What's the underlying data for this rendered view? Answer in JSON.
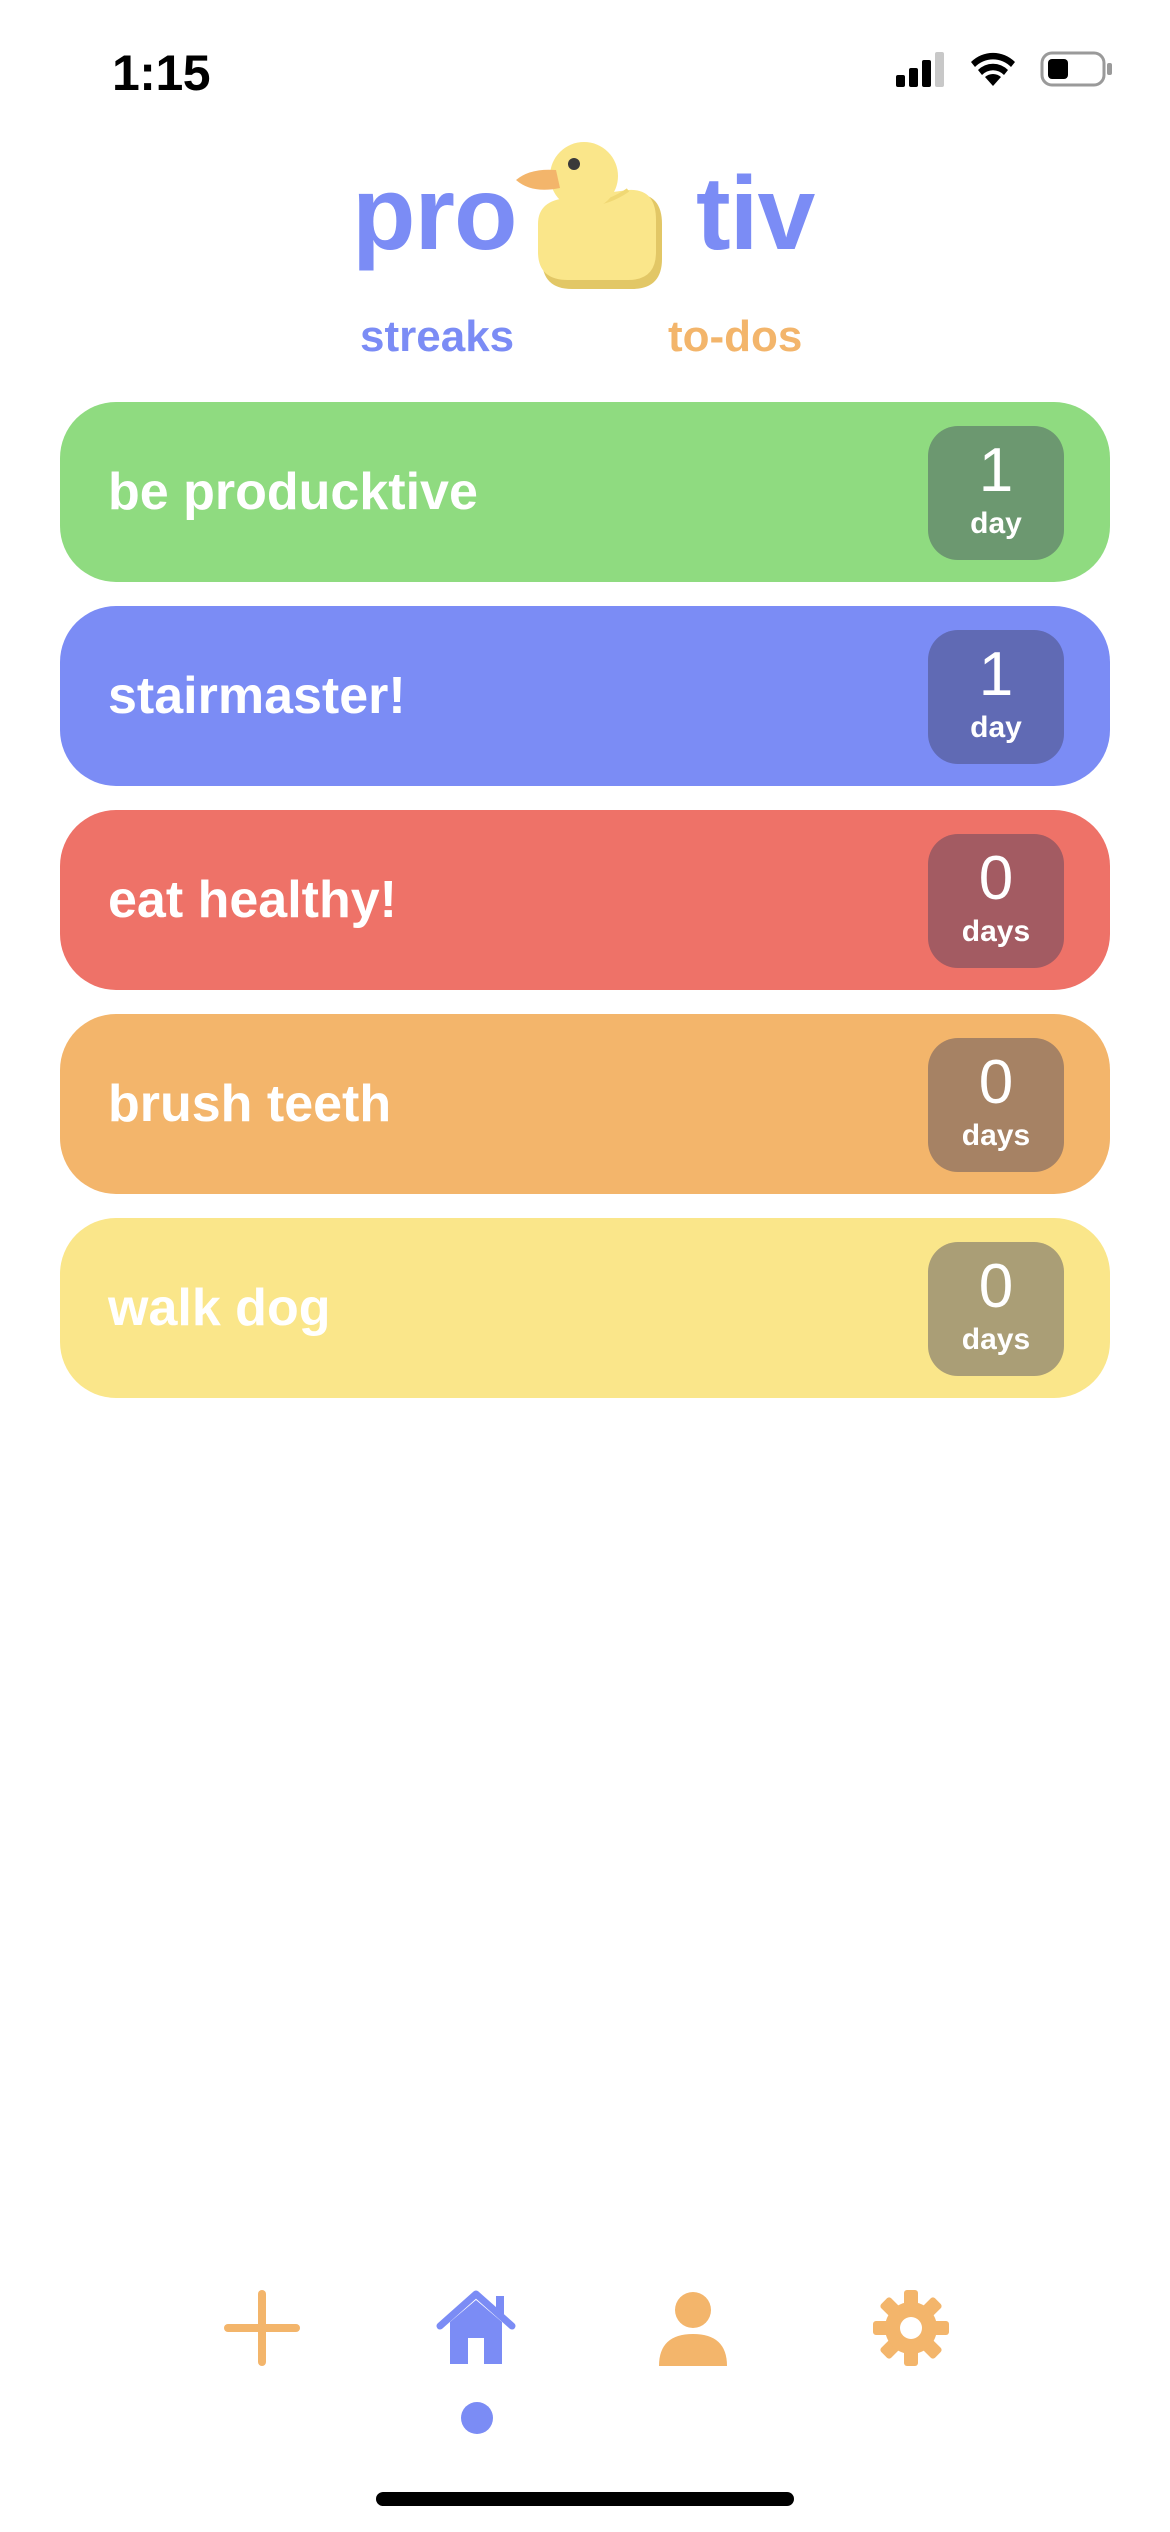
{
  "status_bar": {
    "time": "1:15"
  },
  "header": {
    "logo_left": "pro",
    "logo_right": "tiv",
    "mascot_icon": "duck-icon"
  },
  "tabs": [
    {
      "label": "streaks",
      "color": "#7b8cf5",
      "active": true
    },
    {
      "label": "to-dos",
      "color": "#f3b56b",
      "active": false
    }
  ],
  "streaks": [
    {
      "name": "be producktive",
      "count": "1",
      "unit": "day",
      "color": "#8fdb80"
    },
    {
      "name": "stairmaster!",
      "count": "1",
      "unit": "day",
      "color": "#7b8cf5"
    },
    {
      "name": "eat healthy!",
      "count": "0",
      "unit": "days",
      "color": "#ee7268"
    },
    {
      "name": "brush teeth",
      "count": "0",
      "unit": "days",
      "color": "#f3b56b"
    },
    {
      "name": "walk dog",
      "count": "0",
      "unit": "days",
      "color": "#fae68a"
    }
  ],
  "bottom_nav": {
    "items": [
      {
        "icon": "plus-icon",
        "color": "#f3b56b"
      },
      {
        "icon": "home-icon",
        "color": "#7b8cf5",
        "active": true
      },
      {
        "icon": "person-icon",
        "color": "#f3b56b"
      },
      {
        "icon": "gear-icon",
        "color": "#f3b56b"
      }
    ]
  }
}
